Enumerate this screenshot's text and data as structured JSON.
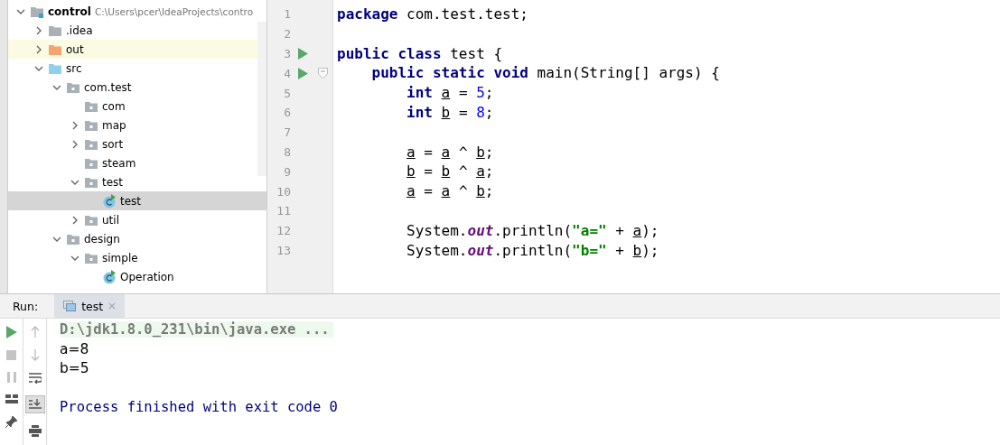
{
  "project_tree": [
    {
      "label": "control",
      "path": "C:\\Users\\pcer\\IdeaProjects\\contro",
      "kind": "project",
      "expanded": true,
      "selected": false,
      "children": [
        {
          "label": ".idea",
          "kind": "folder",
          "expanded": false,
          "selected": false
        },
        {
          "label": "out",
          "kind": "excluded",
          "expanded": false,
          "selected": false
        },
        {
          "label": "src",
          "kind": "source",
          "expanded": true,
          "selected": false,
          "children": [
            {
              "label": "com.test",
              "kind": "package",
              "expanded": true,
              "selected": false,
              "children": [
                {
                  "label": "com",
                  "kind": "package",
                  "selected": false
                },
                {
                  "label": "map",
                  "kind": "package",
                  "expanded": false,
                  "selected": false
                },
                {
                  "label": "sort",
                  "kind": "package",
                  "expanded": false,
                  "selected": false
                },
                {
                  "label": "steam",
                  "kind": "package",
                  "selected": false
                },
                {
                  "label": "test",
                  "kind": "package",
                  "expanded": true,
                  "selected": false,
                  "children": [
                    {
                      "label": "test",
                      "kind": "class",
                      "selected": true
                    }
                  ]
                },
                {
                  "label": "util",
                  "kind": "package",
                  "expanded": false,
                  "selected": false
                }
              ]
            },
            {
              "label": "design",
              "kind": "package",
              "expanded": true,
              "selected": false,
              "children": [
                {
                  "label": "simple",
                  "kind": "package",
                  "expanded": true,
                  "selected": false,
                  "children": [
                    {
                      "label": "Operation",
                      "kind": "class",
                      "selected": false
                    }
                  ]
                }
              ]
            }
          ]
        }
      ]
    }
  ],
  "editor": {
    "lines": [
      {
        "number": "1",
        "tokens": [
          {
            "text": "package",
            "kind": "kw"
          },
          {
            "text": " com.test.test;",
            "kind": "plain"
          }
        ]
      },
      {
        "number": "2"
      },
      {
        "number": "3",
        "run": true,
        "tokens": [
          {
            "text": "public class",
            "kind": "kw"
          },
          {
            "text": " test {",
            "kind": "plain"
          }
        ]
      },
      {
        "number": "4",
        "run": true,
        "fold": true,
        "tokens": [
          {
            "text": "    public static void",
            "kind": "kw"
          },
          {
            "text": " main(String[] args) {",
            "kind": "plain"
          }
        ]
      },
      {
        "number": "5",
        "tokens": [
          {
            "text": "        int ",
            "kind": "kw"
          },
          {
            "text": "a",
            "kind": "var"
          },
          {
            "text": " = ",
            "kind": "plain"
          },
          {
            "text": "5",
            "kind": "num"
          },
          {
            "text": ";",
            "kind": "plain"
          }
        ]
      },
      {
        "number": "6",
        "tokens": [
          {
            "text": "        int ",
            "kind": "kw"
          },
          {
            "text": "b",
            "kind": "var"
          },
          {
            "text": " = ",
            "kind": "plain"
          },
          {
            "text": "8",
            "kind": "num"
          },
          {
            "text": ";",
            "kind": "plain"
          }
        ]
      },
      {
        "number": "7"
      },
      {
        "number": "8",
        "tokens": [
          {
            "text": "        a",
            "kind": "var"
          },
          {
            "text": " = ",
            "kind": "plain"
          },
          {
            "text": "a",
            "kind": "var"
          },
          {
            "text": " ^ ",
            "kind": "plain"
          },
          {
            "text": "b",
            "kind": "var"
          },
          {
            "text": ";",
            "kind": "plain"
          }
        ]
      },
      {
        "number": "9",
        "tokens": [
          {
            "text": "        b",
            "kind": "var"
          },
          {
            "text": " = ",
            "kind": "plain"
          },
          {
            "text": "b",
            "kind": "var"
          },
          {
            "text": " ^ ",
            "kind": "plain"
          },
          {
            "text": "a",
            "kind": "var"
          },
          {
            "text": ";",
            "kind": "plain"
          }
        ]
      },
      {
        "number": "10",
        "tokens": [
          {
            "text": "        a",
            "kind": "var"
          },
          {
            "text": " = ",
            "kind": "plain"
          },
          {
            "text": "a",
            "kind": "var"
          },
          {
            "text": " ^ ",
            "kind": "plain"
          },
          {
            "text": "b",
            "kind": "var"
          },
          {
            "text": ";",
            "kind": "plain"
          }
        ]
      },
      {
        "number": "11"
      },
      {
        "number": "12",
        "tokens": [
          {
            "text": "        System.",
            "kind": "plain"
          },
          {
            "text": "out",
            "kind": "field"
          },
          {
            "text": ".println(",
            "kind": "plain"
          },
          {
            "text": "\"a=\"",
            "kind": "str"
          },
          {
            "text": " + ",
            "kind": "plain"
          },
          {
            "text": "a",
            "kind": "var"
          },
          {
            "text": ");",
            "kind": "plain"
          }
        ]
      },
      {
        "number": "13",
        "tokens": [
          {
            "text": "        System.",
            "kind": "plain"
          },
          {
            "text": "out",
            "kind": "field"
          },
          {
            "text": ".println(",
            "kind": "plain"
          },
          {
            "text": "\"b=\"",
            "kind": "str"
          },
          {
            "text": " + ",
            "kind": "plain"
          },
          {
            "text": "b",
            "kind": "var"
          },
          {
            "text": ");",
            "kind": "plain"
          }
        ]
      }
    ]
  },
  "run_panel": {
    "label": "Run:",
    "tabs": [
      {
        "label": "test",
        "selected": true
      }
    ],
    "console": [
      {
        "text": "D:\\jdk1.8.0_231\\bin\\java.exe ...",
        "kind": "command"
      },
      {
        "text": "a=8",
        "kind": "output"
      },
      {
        "text": "b=5",
        "kind": "output"
      },
      {
        "kind": "blank"
      },
      {
        "text": "Process finished with exit code 0",
        "kind": "exit"
      }
    ]
  }
}
